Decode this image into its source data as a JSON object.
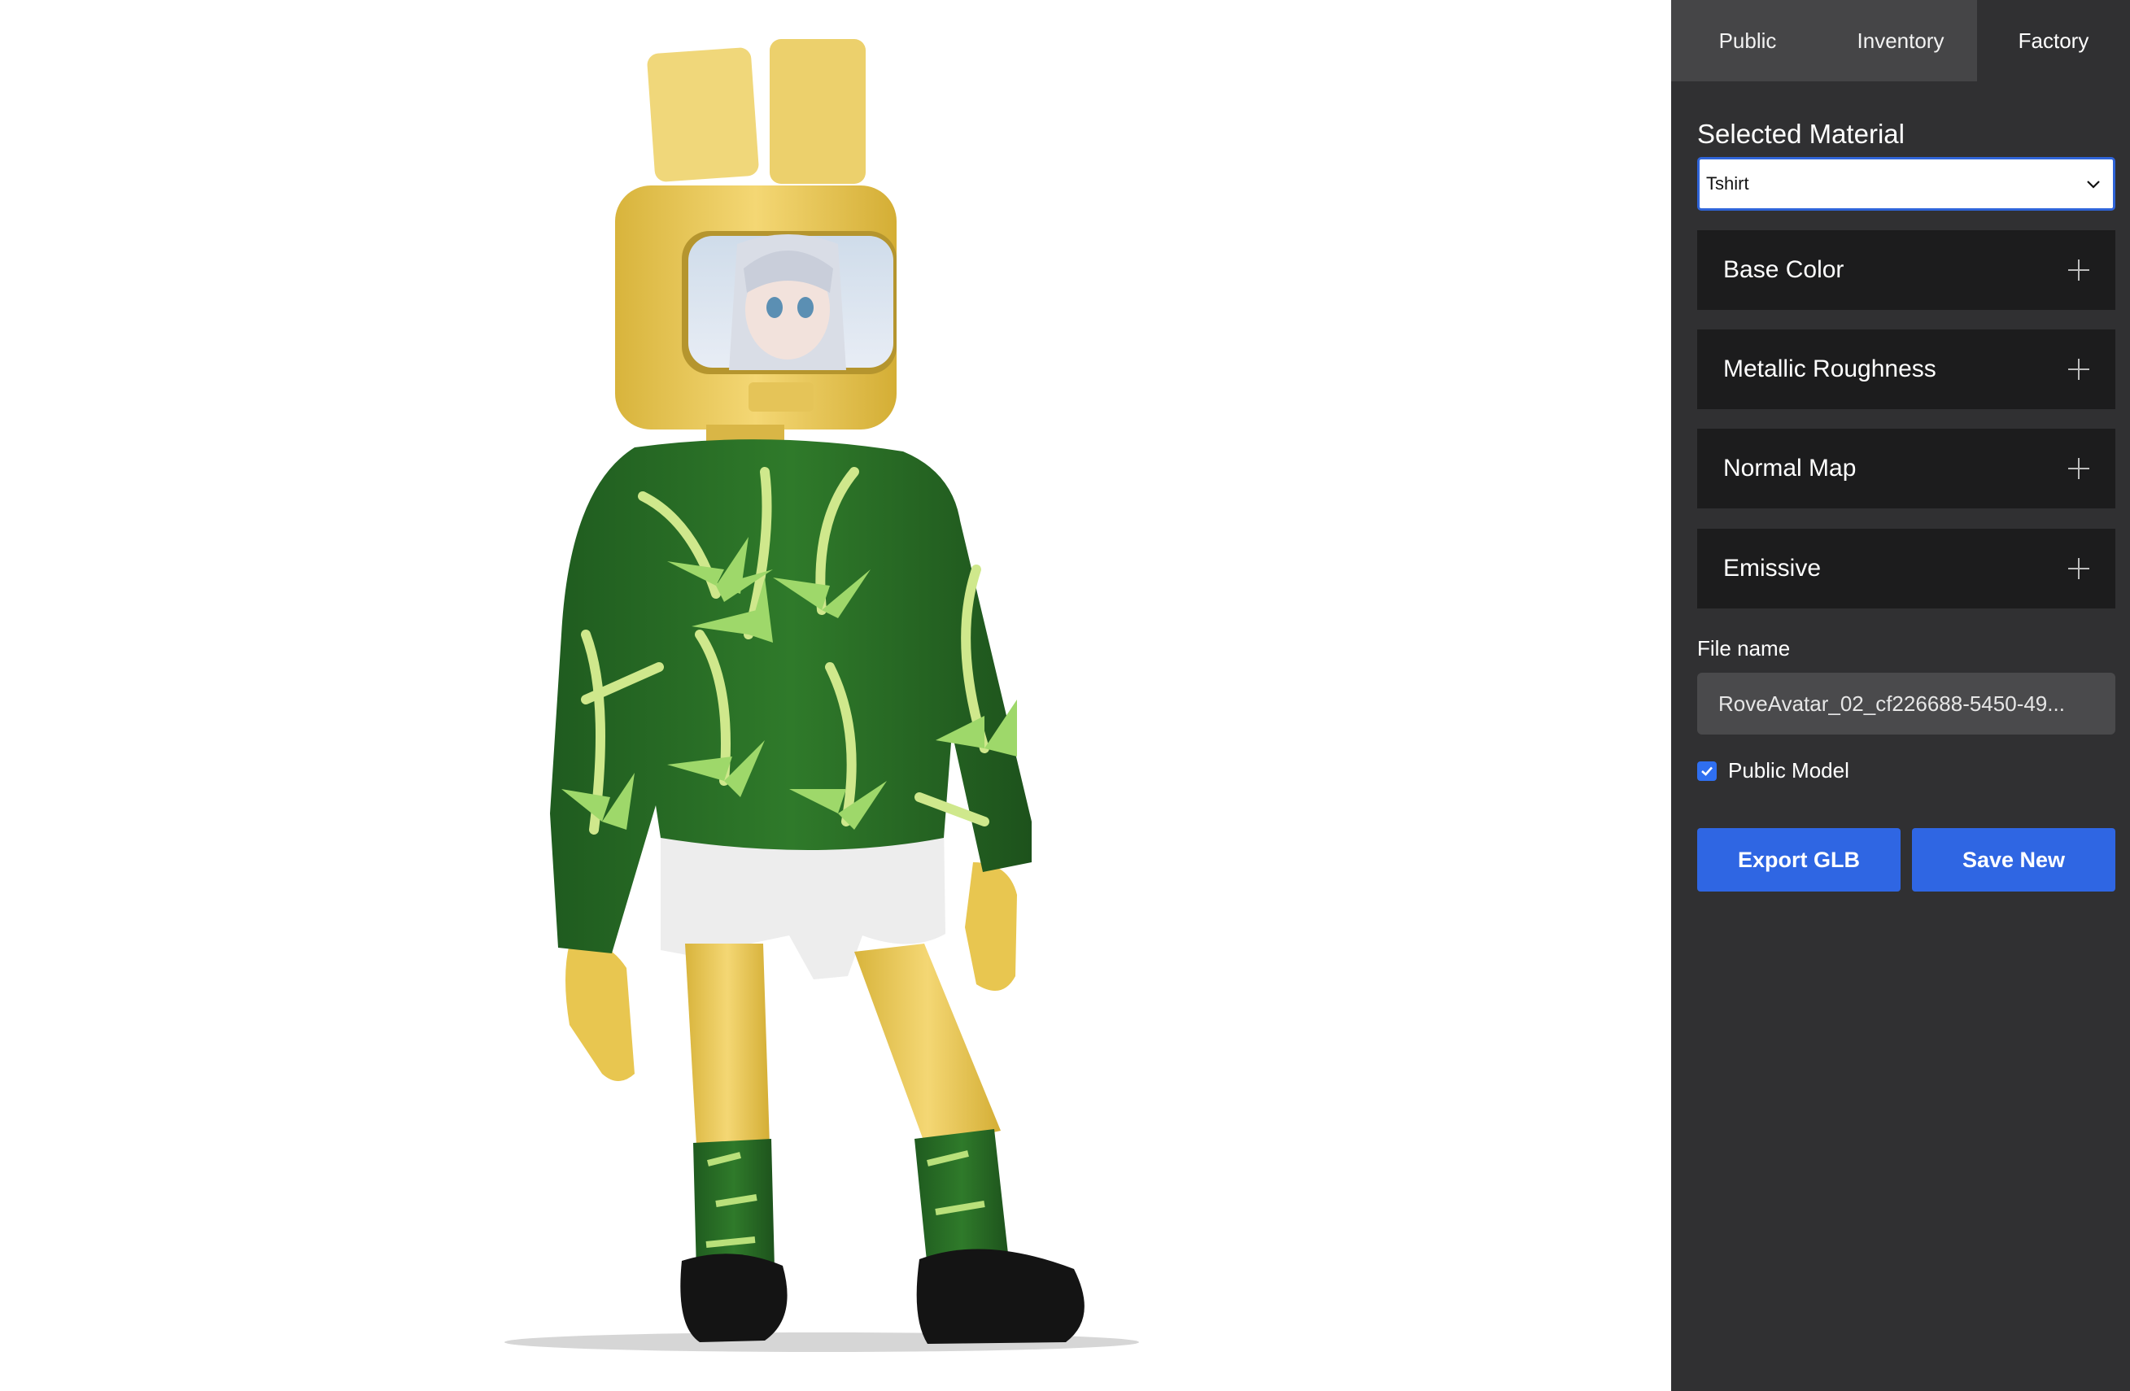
{
  "tabs": [
    {
      "label": "Public"
    },
    {
      "label": "Inventory"
    },
    {
      "label": "Factory"
    }
  ],
  "active_tab": "Factory",
  "material": {
    "title": "Selected Material",
    "selected": "Tshirt"
  },
  "sections": [
    {
      "label": "Base Color"
    },
    {
      "label": "Metallic Roughness"
    },
    {
      "label": "Normal Map"
    },
    {
      "label": "Emissive"
    }
  ],
  "file": {
    "label": "File name",
    "value": "RoveAvatar_02_cf226688-5450-49..."
  },
  "public_model": {
    "label": "Public Model",
    "checked": true
  },
  "actions": {
    "export_label": "Export GLB",
    "save_label": "Save New"
  },
  "colors": {
    "panel_bg": "#303032",
    "tab_bg": "#454547",
    "accent": "#2f66e3",
    "accordion_bg": "#1c1c1d"
  }
}
